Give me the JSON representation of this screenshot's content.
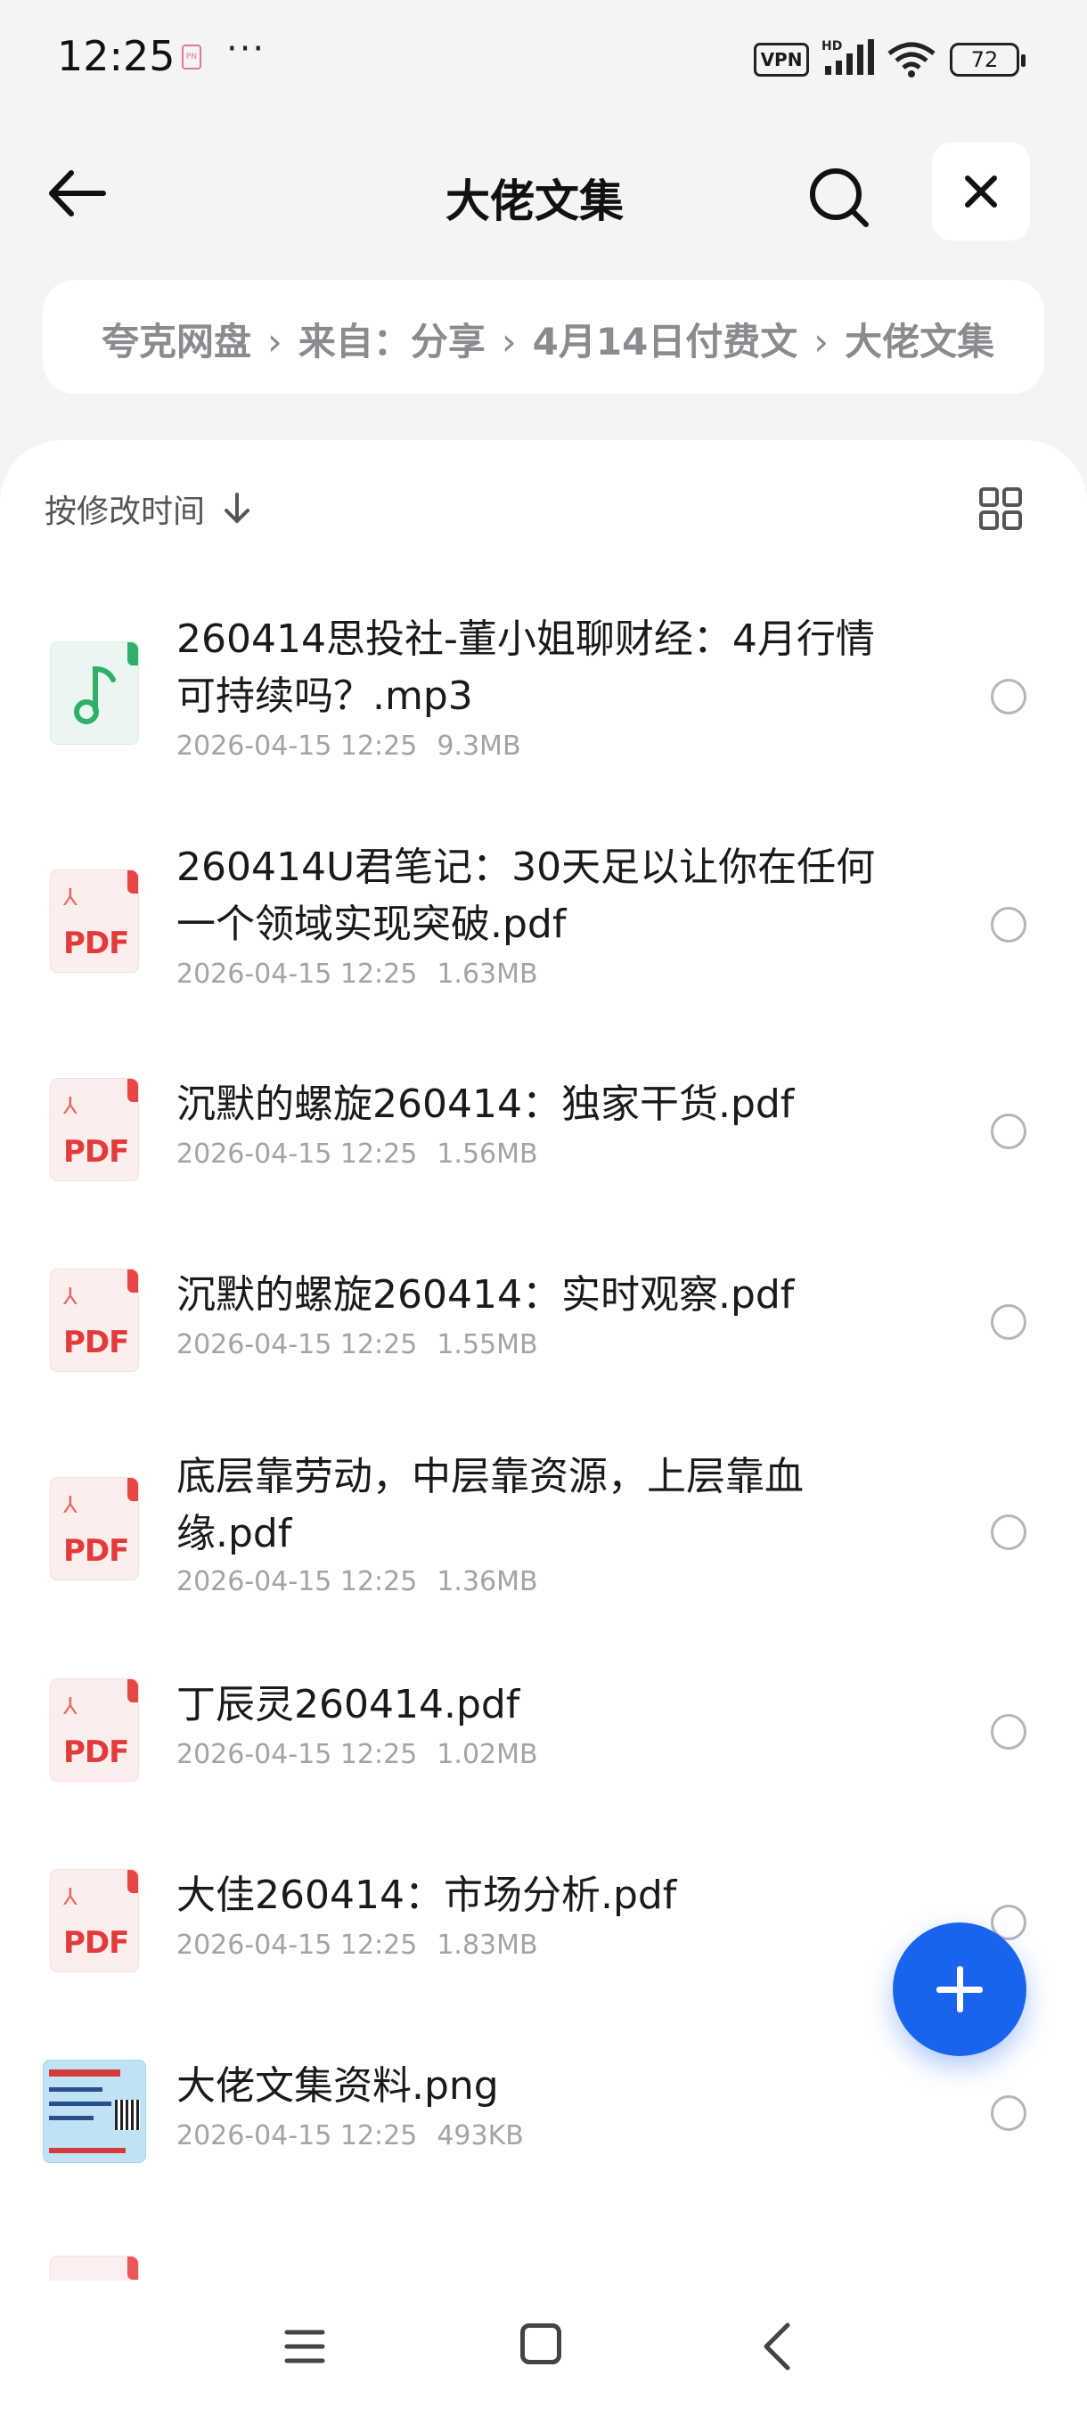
{
  "status_bar": {
    "time": "12:25",
    "app_icon": "notification-app-icon",
    "more": "···",
    "vpn": "VPN",
    "hd": "HD",
    "battery": "72"
  },
  "header": {
    "title": "大佬文集",
    "back_icon": "arrow-left-icon",
    "search_icon": "search-icon",
    "close_icon": "close-icon"
  },
  "breadcrumb": {
    "items": [
      "夸克网盘",
      "来自：分享",
      "4月14日付费文",
      "大佬文集"
    ],
    "separator": "›"
  },
  "sort": {
    "label": "按修改时间",
    "direction_icon": "arrow-down-icon",
    "view_toggle_icon": "grid-view-icon"
  },
  "files": [
    {
      "type": "mp3",
      "name": "260414思投社-董小姐聊财经：4月行情可持续吗？.mp3",
      "date": "2026-04-15 12:25",
      "size": "9.3MB"
    },
    {
      "type": "pdf",
      "name": "260414U君笔记：30天足以让你在任何一个领域实现突破.pdf",
      "date": "2026-04-15 12:25",
      "size": "1.63MB"
    },
    {
      "type": "pdf",
      "name": "沉默的螺旋260414：独家干货.pdf",
      "date": "2026-04-15 12:25",
      "size": "1.56MB"
    },
    {
      "type": "pdf",
      "name": "沉默的螺旋260414：实时观察.pdf",
      "date": "2026-04-15 12:25",
      "size": "1.55MB"
    },
    {
      "type": "pdf",
      "name": "底层靠劳动，中层靠资源，上层靠血缘.pdf",
      "date": "2026-04-15 12:25",
      "size": "1.36MB"
    },
    {
      "type": "pdf",
      "name": "丁辰灵260414.pdf",
      "date": "2026-04-15 12:25",
      "size": "1.02MB"
    },
    {
      "type": "pdf",
      "name": "大佳260414：市场分析.pdf",
      "date": "2026-04-15 12:25",
      "size": "1.83MB"
    },
    {
      "type": "png",
      "name": "大佬文集资料.png",
      "date": "2026-04-15 12:25",
      "size": "493KB"
    }
  ],
  "fab_icon": "plus-icon",
  "nav": {
    "menu_icon": "menu-icon",
    "home_icon": "home-icon",
    "back_icon": "back-icon"
  },
  "colors": {
    "accent": "#1a63ec",
    "pdf_red": "#e23b3b",
    "mp3_green": "#2eaf6a",
    "meta_gray": "#a3a3a8"
  }
}
